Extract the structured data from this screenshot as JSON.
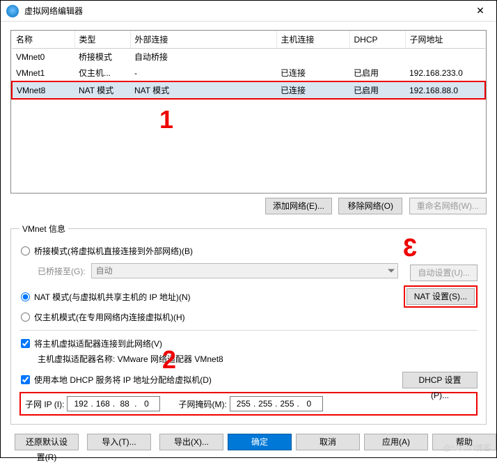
{
  "window": {
    "title": "虚拟网络编辑器"
  },
  "table": {
    "headers": [
      "名称",
      "类型",
      "外部连接",
      "主机连接",
      "DHCP",
      "子网地址"
    ],
    "rows": [
      {
        "cells": [
          "VMnet0",
          "桥接模式",
          "自动桥接",
          "",
          "",
          ""
        ],
        "selected": false
      },
      {
        "cells": [
          "VMnet1",
          "仅主机...",
          "-",
          "已连接",
          "已启用",
          "192.168.233.0"
        ],
        "selected": false
      },
      {
        "cells": [
          "VMnet8",
          "NAT 模式",
          "NAT 模式",
          "已连接",
          "已启用",
          "192.168.88.0"
        ],
        "selected": true
      }
    ]
  },
  "netbtns": {
    "add": "添加网络(E)...",
    "remove": "移除网络(O)",
    "rename": "重命名网络(W)..."
  },
  "vmnet": {
    "legend": "VMnet 信息",
    "bridged_label": "桥接模式(将虚拟机直接连接到外部网络)(B)",
    "bridged_to_label": "已桥接至(G):",
    "bridged_to_value": "自动",
    "auto_settings": "自动设置(U)...",
    "nat_label": "NAT 模式(与虚拟机共享主机的 IP 地址)(N)",
    "nat_settings": "NAT 设置(S)...",
    "host_label": "仅主机模式(在专用网络内连接虚拟机)(H)",
    "connect_host_label": "将主机虚拟适配器连接到此网络(V)",
    "host_adapter_label": "主机虚拟适配器名称: VMware 网络适配器 VMnet8",
    "dhcp_chk_label": "使用本地 DHCP 服务将 IP 地址分配给虚拟机(D)",
    "dhcp_settings": "DHCP 设置(P)...",
    "subnet_ip_label": "子网 IP (I):",
    "subnet_ip": [
      "192",
      "168",
      "88",
      "0"
    ],
    "subnet_mask_label": "子网掩码(M):",
    "subnet_mask": [
      "255",
      "255",
      "255",
      "0"
    ]
  },
  "bottom": {
    "restore": "还原默认设置(R)",
    "import": "导入(T)...",
    "export": "导出(X)...",
    "ok": "确定",
    "cancel": "取消",
    "apply": "应用(A)",
    "help": "帮助"
  },
  "watermark": "@51CTO博客"
}
